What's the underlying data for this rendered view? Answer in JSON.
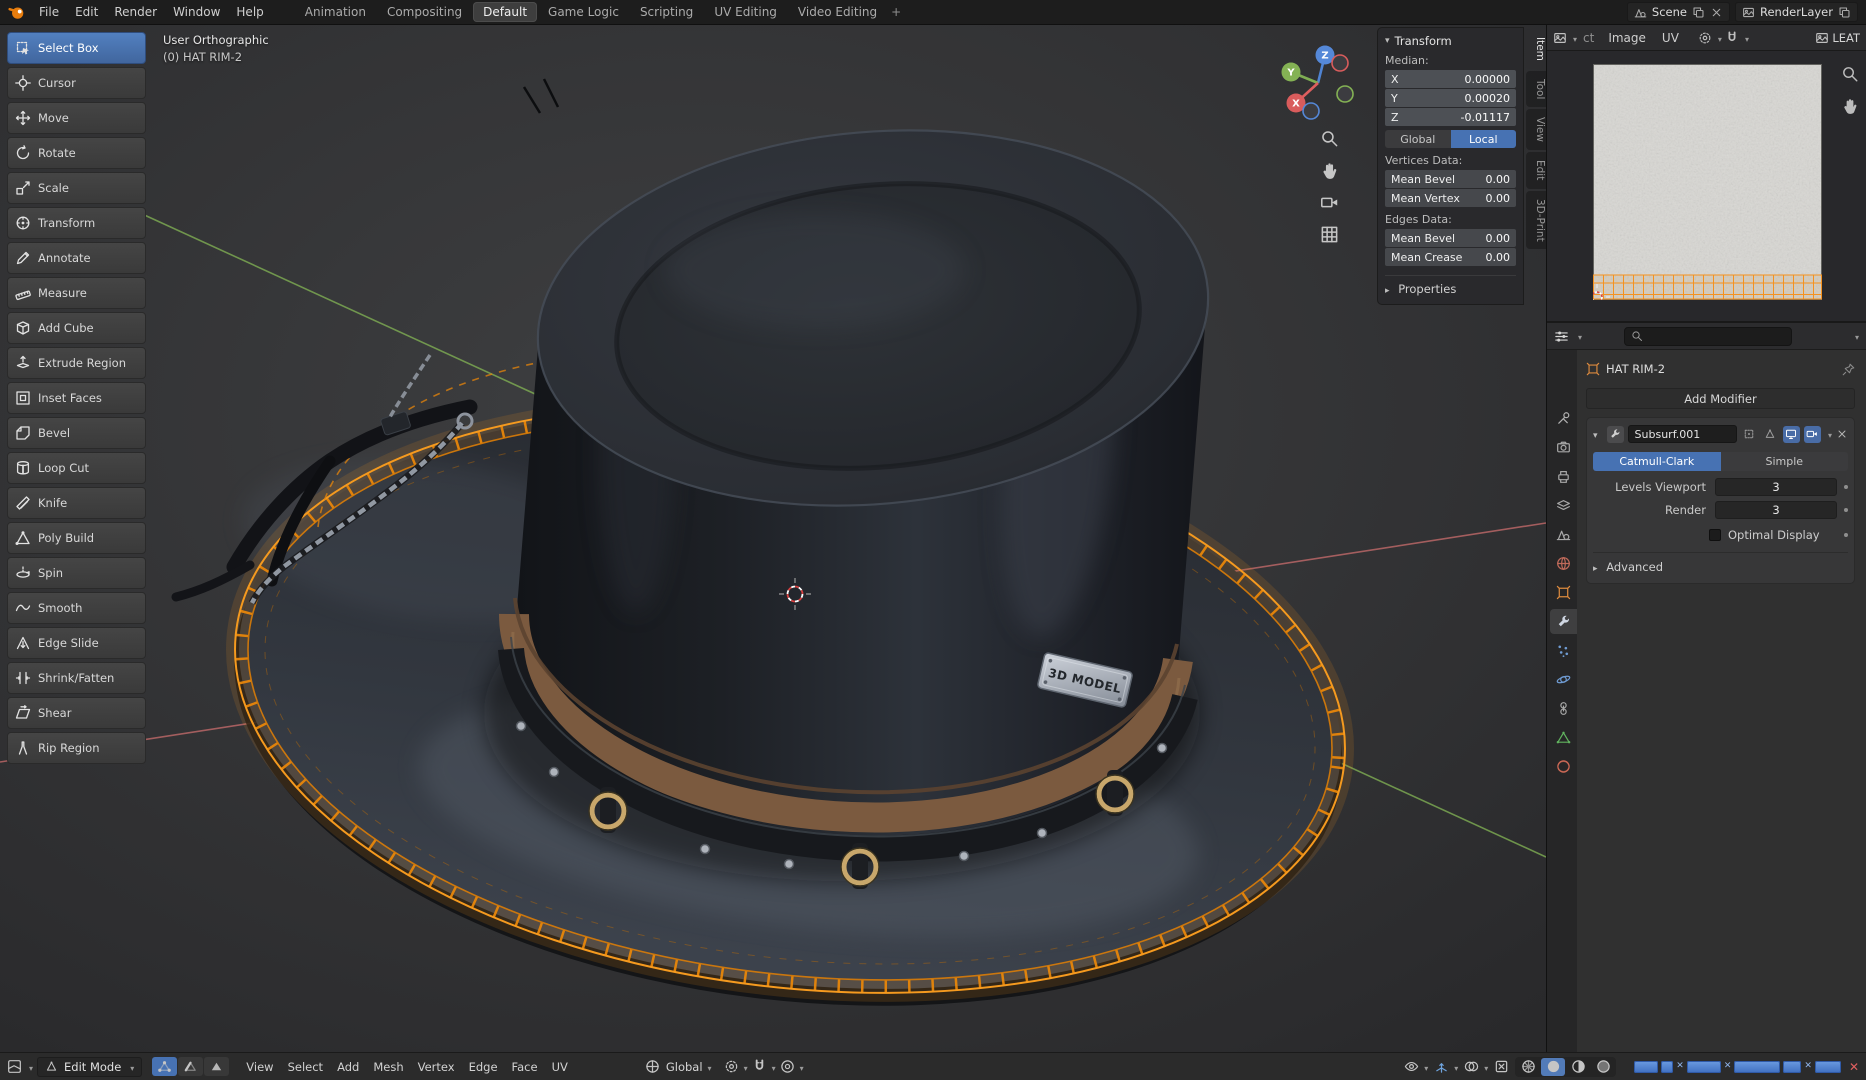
{
  "colors": {
    "accent": "#4772b3",
    "selection_orange": "#f5921f",
    "axis_x": "#dd5e5e",
    "axis_y": "#7fae53",
    "axis_z": "#4f83d2"
  },
  "topbar": {
    "menus": [
      "File",
      "Edit",
      "Render",
      "Window",
      "Help"
    ],
    "workspaces": [
      "Animation",
      "Compositing",
      "Default",
      "Game Logic",
      "Scripting",
      "UV Editing",
      "Video Editing"
    ],
    "active_workspace": "Default",
    "add_workspace": "+",
    "scene_label": "Scene",
    "render_layer_label": "RenderLayer"
  },
  "tool_shelf": {
    "tools": [
      {
        "label": "Select Box",
        "icon": "select-box-icon",
        "active": true
      },
      {
        "label": "Cursor",
        "icon": "cursor-icon",
        "active": false
      },
      {
        "label": "Move",
        "icon": "move-icon",
        "active": false
      },
      {
        "label": "Rotate",
        "icon": "rotate-icon",
        "active": false
      },
      {
        "label": "Scale",
        "icon": "scale-icon",
        "active": false
      },
      {
        "label": "Transform",
        "icon": "transform-icon",
        "active": false
      },
      {
        "label": "Annotate",
        "icon": "annotate-icon",
        "active": false
      },
      {
        "label": "Measure",
        "icon": "measure-icon",
        "active": false
      },
      {
        "label": "Add Cube",
        "icon": "add-cube-icon",
        "active": false
      },
      {
        "label": "Extrude Region",
        "icon": "extrude-region-icon",
        "active": false
      },
      {
        "label": "Inset Faces",
        "icon": "inset-faces-icon",
        "active": false
      },
      {
        "label": "Bevel",
        "icon": "bevel-icon",
        "active": false
      },
      {
        "label": "Loop Cut",
        "icon": "loop-cut-icon",
        "active": false
      },
      {
        "label": "Knife",
        "icon": "knife-icon",
        "active": false
      },
      {
        "label": "Poly Build",
        "icon": "poly-build-icon",
        "active": false
      },
      {
        "label": "Spin",
        "icon": "spin-icon",
        "active": false
      },
      {
        "label": "Smooth",
        "icon": "smooth-icon",
        "active": false
      },
      {
        "label": "Edge Slide",
        "icon": "edge-slide-icon",
        "active": false
      },
      {
        "label": "Shrink/Fatten",
        "icon": "shrink-fatten-icon",
        "active": false
      },
      {
        "label": "Shear",
        "icon": "shear-icon",
        "active": false
      },
      {
        "label": "Rip Region",
        "icon": "rip-region-icon",
        "active": false
      }
    ]
  },
  "viewport": {
    "header_line1": "User Orthographic",
    "header_line2": "(0) HAT RIM-2",
    "plate_label": "3D MODEL",
    "gizmo": {
      "x_label": "X",
      "y_label": "Y",
      "z_label": "Z"
    }
  },
  "sidebar": {
    "tabs": [
      {
        "label": "Item",
        "active": true
      },
      {
        "label": "Tool",
        "active": false
      },
      {
        "label": "View",
        "active": false
      },
      {
        "label": "Edit",
        "active": false
      },
      {
        "label": "3D-Print",
        "active": false
      }
    ],
    "transform": {
      "title": "Transform",
      "median_label": "Median:",
      "median": [
        {
          "axis": "X",
          "value": "0.00000"
        },
        {
          "axis": "Y",
          "value": "0.00020"
        },
        {
          "axis": "Z",
          "value": "-0.01117"
        }
      ],
      "space_buttons": [
        {
          "label": "Global",
          "active": false
        },
        {
          "label": "Local",
          "active": true
        }
      ],
      "vertices_section": "Vertices Data:",
      "vertices_rows": [
        {
          "label": "Mean Bevel",
          "value": "0.00"
        },
        {
          "label": "Mean Vertex",
          "value": "0.00"
        }
      ],
      "edges_section": "Edges Data:",
      "edges_rows": [
        {
          "label": "Mean Bevel",
          "value": "0.00"
        },
        {
          "label": "Mean Crease",
          "value": "0.00"
        }
      ],
      "properties_label": "Properties"
    }
  },
  "uv_editor": {
    "truncated_menu": "ct",
    "menus": [
      "Image",
      "UV"
    ],
    "image_name": "LEAT"
  },
  "properties_editor": {
    "tabs": [
      {
        "icon": "tool-icon",
        "color": "#b0b0b0",
        "active": false
      },
      {
        "icon": "render-icon",
        "color": "#a8a8a8",
        "active": false
      },
      {
        "icon": "output-icon",
        "color": "#a8a8a8",
        "active": false
      },
      {
        "icon": "view-layer-icon",
        "color": "#a8a8a8",
        "active": false
      },
      {
        "icon": "scene-icon",
        "color": "#a8a8a8",
        "active": false
      },
      {
        "icon": "world-icon",
        "color": "#c06a5a",
        "active": false
      },
      {
        "icon": "object-icon",
        "color": "#dd8a3e",
        "active": false
      },
      {
        "icon": "modifiers-icon",
        "color": "#cfd6e2",
        "active": true
      },
      {
        "icon": "particles-icon",
        "color": "#6f9bd2",
        "active": false
      },
      {
        "icon": "physics-icon",
        "color": "#6f9bd2",
        "active": false
      },
      {
        "icon": "constraints-icon",
        "color": "#a8a8a8",
        "active": false
      },
      {
        "icon": "object-data-icon",
        "color": "#61b35f",
        "active": false
      },
      {
        "icon": "material-icon",
        "color": "#cf6a57",
        "active": false
      }
    ],
    "context_object": "HAT RIM-2",
    "add_modifier_label": "Add Modifier",
    "modifier": {
      "name": "Subsurf.001",
      "subdivision_types": [
        {
          "label": "Catmull-Clark",
          "active": true
        },
        {
          "label": "Simple",
          "active": false
        }
      ],
      "rows": [
        {
          "label": "Levels Viewport",
          "value": "3"
        },
        {
          "label": "Render",
          "value": "3"
        }
      ],
      "optimal_display_label": "Optimal Display",
      "advanced_label": "Advanced"
    }
  },
  "status_bar": {
    "mode_label": "Edit Mode",
    "menus": [
      "View",
      "Select",
      "Add",
      "Mesh",
      "Vertex",
      "Edge",
      "Face",
      "UV"
    ],
    "orientation_label": "Global"
  }
}
